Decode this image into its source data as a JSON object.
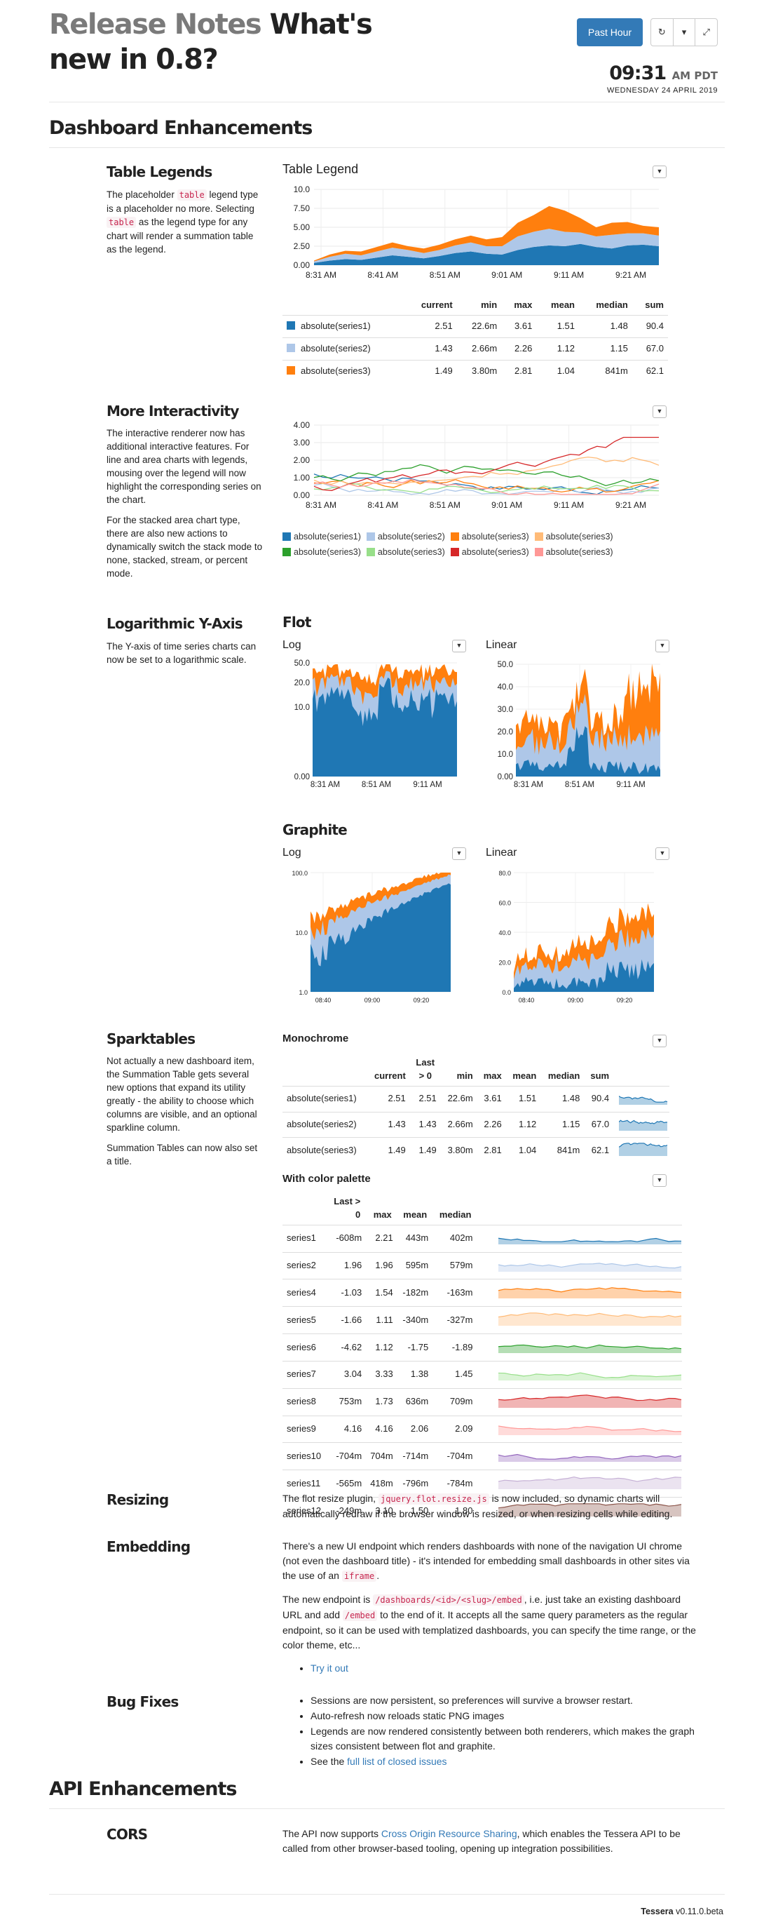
{
  "header": {
    "title_muted": "Release Notes",
    "title_main": "What's new in 0.8?",
    "range_button": "Past Hour",
    "refresh_icon": "refresh-icon",
    "dropdown_icon": "caret-down-icon",
    "fullscreen_icon": "compress-icon",
    "clock_time": "09:31",
    "clock_zone": "AM PDT",
    "clock_date": "WEDNESDAY 24 APRIL 2019"
  },
  "sections": {
    "dashboard": "Dashboard Enhancements",
    "api": "API Enhancements"
  },
  "table_legends": {
    "heading": "Table Legends",
    "desc_1": "The placeholder",
    "code_table": "table",
    "desc_2": "legend type is a placeholder no more. Selecting",
    "desc_3": "as the legend type for any chart will render a summation table as the legend.",
    "chart_title": "Table Legend",
    "columns": [
      "",
      "current",
      "min",
      "max",
      "mean",
      "median",
      "sum"
    ],
    "rows": [
      {
        "name": "absolute(series1)",
        "color": "#1f77b4",
        "values": [
          "2.51",
          "22.6m",
          "3.61",
          "1.51",
          "1.48",
          "90.4"
        ]
      },
      {
        "name": "absolute(series2)",
        "color": "#aec7e8",
        "values": [
          "1.43",
          "2.66m",
          "2.26",
          "1.12",
          "1.15",
          "67.0"
        ]
      },
      {
        "name": "absolute(series3)",
        "color": "#ff7f0e",
        "values": [
          "1.49",
          "3.80m",
          "2.81",
          "1.04",
          "841m",
          "62.1"
        ]
      }
    ]
  },
  "interactivity": {
    "heading": "More Interactivity",
    "p1": "The interactive renderer now has additional interactive features. For line and area charts with legends, mousing over the legend will now highlight the corresponding series on the chart.",
    "p2": "For the stacked area chart type, there are also new actions to dynamically switch the stack mode to none, stacked, stream, or percent mode.",
    "legend": [
      {
        "name": "absolute(series1)",
        "color": "#1f77b4"
      },
      {
        "name": "absolute(series2)",
        "color": "#aec7e8"
      },
      {
        "name": "absolute(series3)",
        "color": "#ff7f0e"
      },
      {
        "name": "absolute(series3)",
        "color": "#ffbb78"
      },
      {
        "name": "absolute(series3)",
        "color": "#2ca02c"
      },
      {
        "name": "absolute(series3)",
        "color": "#98df8a"
      },
      {
        "name": "absolute(series3)",
        "color": "#d62728"
      },
      {
        "name": "absolute(series3)",
        "color": "#ff9896"
      }
    ]
  },
  "log_axis": {
    "heading": "Logarithmic Y-Axis",
    "desc": "The Y-axis of time series charts can now be set to a logarithmic scale.",
    "flot_title": "Flot",
    "graphite_title": "Graphite",
    "log_label": "Log",
    "linear_label": "Linear"
  },
  "sparktables": {
    "heading": "Sparktables",
    "p1": "Not actually a new dashboard item, the Summation Table gets several new options that expand its utility greatly - the ability to choose which columns are visible, and an optional sparkline column.",
    "p2": "Summation Tables can now also set a title.",
    "mono_title": "Monochrome",
    "mono_columns": [
      "",
      "current",
      "Last > 0",
      "min",
      "max",
      "mean",
      "median",
      "sum"
    ],
    "mono_rows": [
      {
        "name": "absolute(series1)",
        "values": [
          "2.51",
          "2.51",
          "22.6m",
          "3.61",
          "1.51",
          "1.48",
          "90.4"
        ]
      },
      {
        "name": "absolute(series2)",
        "values": [
          "1.43",
          "1.43",
          "2.66m",
          "2.26",
          "1.12",
          "1.15",
          "67.0"
        ]
      },
      {
        "name": "absolute(series3)",
        "values": [
          "1.49",
          "1.49",
          "3.80m",
          "2.81",
          "1.04",
          "841m",
          "62.1"
        ]
      }
    ],
    "color_title": "With color palette",
    "color_columns": [
      "",
      "Last > 0",
      "max",
      "mean",
      "median"
    ],
    "color_rows": [
      {
        "name": "series1",
        "values": [
          "-608m",
          "2.21",
          "443m",
          "402m"
        ],
        "color": "#1f77b4"
      },
      {
        "name": "series2",
        "values": [
          "1.96",
          "1.96",
          "595m",
          "579m"
        ],
        "color": "#aec7e8"
      },
      {
        "name": "series4",
        "values": [
          "-1.03",
          "1.54",
          "-182m",
          "-163m"
        ],
        "color": "#ff7f0e"
      },
      {
        "name": "series5",
        "values": [
          "-1.66",
          "1.11",
          "-340m",
          "-327m"
        ],
        "color": "#ffbb78"
      },
      {
        "name": "series6",
        "values": [
          "-4.62",
          "1.12",
          "-1.75",
          "-1.89"
        ],
        "color": "#2ca02c"
      },
      {
        "name": "series7",
        "values": [
          "3.04",
          "3.33",
          "1.38",
          "1.45"
        ],
        "color": "#98df8a"
      },
      {
        "name": "series8",
        "values": [
          "753m",
          "1.73",
          "636m",
          "709m"
        ],
        "color": "#d62728"
      },
      {
        "name": "series9",
        "values": [
          "4.16",
          "4.16",
          "2.06",
          "2.09"
        ],
        "color": "#ff9896"
      },
      {
        "name": "series10",
        "values": [
          "-704m",
          "704m",
          "-714m",
          "-704m"
        ],
        "color": "#9467bd"
      },
      {
        "name": "series11",
        "values": [
          "-565m",
          "418m",
          "-796m",
          "-784m"
        ],
        "color": "#c5b0d5"
      },
      {
        "name": "series12",
        "values": [
          "-249m",
          "3.10",
          "1.50",
          "1.80"
        ],
        "color": "#8c564b"
      }
    ]
  },
  "resizing": {
    "heading": "Resizing",
    "p1a": "The flot resize plugin,",
    "code": "jquery.flot.resize.js",
    "p1b": "is now included, so dynamic charts will automatically redraw if the browser window is resized, or when resizing cells while editing."
  },
  "embedding": {
    "heading": "Embedding",
    "p1a": "There's a new UI endpoint which renders dashboards with none of the navigation UI chrome (not even the dashboard title) - it's intended for embedding small dashboards in other sites via the use of an",
    "code_iframe": "iframe",
    "p2a": "The new endpoint is",
    "code_endpoint": "/dashboards/<id>/<slug>/embed",
    "p2b": ", i.e. just take an existing dashboard URL and add",
    "code_embed": "/embed",
    "p2c": "to the end of it. It accepts all the same query parameters as the regular endpoint, so it can be used with templatized dashboards, you can specify the time range, or the color theme, etc...",
    "link": "Try it out"
  },
  "bugfixes": {
    "heading": "Bug Fixes",
    "items": [
      "Sessions are now persistent, so preferences will survive a browser restart.",
      "Auto-refresh now reloads static PNG images",
      "Legends are now rendered consistently between both renderers, which makes the graph sizes consistent between flot and graphite."
    ],
    "last_prefix": "See the",
    "last_link": "full list of closed issues"
  },
  "cors": {
    "heading": "CORS",
    "pa": "The API now supports",
    "link": "Cross Origin Resource Sharing",
    "pb": ", which enables the Tessera API to be called from other browser-based tooling, opening up integration possibilities."
  },
  "footer": {
    "brand": "Tessera",
    "version": "v0.11.0.beta"
  },
  "chart_data": [
    {
      "type": "area",
      "title": "Table Legend",
      "x": [
        "8:31 AM",
        "8:41 AM",
        "8:51 AM",
        "9:01 AM",
        "9:11 AM",
        "9:21 AM"
      ],
      "ylim": [
        0,
        10
      ],
      "yticks": [
        "0.00",
        "2.50",
        "5.00",
        "7.50",
        "10.0"
      ],
      "stacked": true,
      "series": [
        {
          "name": "absolute(series1)",
          "color": "#1f77b4",
          "values": [
            0.3,
            0.6,
            0.8,
            0.7,
            1.0,
            1.3,
            1.1,
            0.9,
            1.2,
            1.6,
            1.8,
            1.5,
            1.4,
            2.0,
            2.4,
            2.6,
            2.5,
            2.8,
            2.4,
            2.2,
            2.6,
            2.7,
            2.5
          ]
        },
        {
          "name": "absolute(series2)",
          "color": "#aec7e8",
          "values": [
            0.2,
            0.5,
            0.7,
            0.6,
            0.8,
            1.0,
            0.9,
            0.7,
            0.8,
            1.0,
            1.2,
            1.0,
            1.1,
            1.8,
            2.0,
            2.2,
            1.9,
            1.5,
            1.4,
            1.8,
            1.6,
            1.5,
            1.4
          ]
        },
        {
          "name": "absolute(series3)",
          "color": "#ff7f0e",
          "values": [
            0.1,
            0.3,
            0.4,
            0.5,
            0.6,
            0.7,
            0.5,
            0.6,
            0.7,
            0.8,
            0.9,
            0.9,
            1.2,
            1.8,
            2.2,
            3.0,
            2.8,
            1.9,
            1.2,
            1.6,
            1.5,
            1.0,
            1.1
          ]
        }
      ]
    },
    {
      "type": "line",
      "x": [
        "8:31 AM",
        "8:41 AM",
        "8:51 AM",
        "9:01 AM",
        "9:11 AM",
        "9:21 AM"
      ],
      "ylim": [
        0,
        4
      ],
      "yticks": [
        "0.00",
        "1.00",
        "2.00",
        "3.00",
        "4.00"
      ],
      "series_count": 8
    },
    {
      "type": "area",
      "title": "Flot Log",
      "x": [
        "8:31 AM",
        "8:51 AM",
        "9:11 AM"
      ],
      "yticks": [
        "0.00",
        "10.0",
        "20.0",
        "50.0"
      ],
      "scale": "log"
    },
    {
      "type": "area",
      "title": "Flot Linear",
      "x": [
        "8:31 AM",
        "8:51 AM",
        "9:11 AM"
      ],
      "yticks": [
        "0.00",
        "10.0",
        "20.0",
        "30.0",
        "40.0",
        "50.0"
      ]
    },
    {
      "type": "area",
      "title": "Graphite Log",
      "x": [
        "08:40",
        "09:00",
        "09:20"
      ],
      "yticks": [
        "1.0",
        "10.0",
        "100.0"
      ],
      "scale": "log"
    },
    {
      "type": "area",
      "title": "Graphite Linear",
      "x": [
        "08:40",
        "09:00",
        "09:20"
      ],
      "yticks": [
        "0.0",
        "20.0",
        "40.0",
        "60.0",
        "80.0"
      ]
    }
  ]
}
